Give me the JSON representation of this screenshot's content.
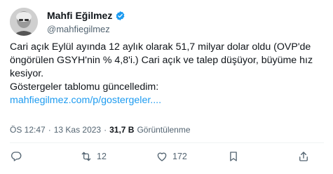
{
  "author": {
    "name": "Mahfi Eğilmez",
    "handle": "@mahfiegilmez",
    "verified": true
  },
  "tweet": {
    "lines": [
      "Cari açık Eylül ayında 12 aylık olarak 51,7 milyar dolar oldu (OVP'de",
      "öngörülen GSYH'nin % 4,8'i.) Cari açık ve talep düşüyor, büyüme hız",
      "kesiyor.",
      "Göstergeler tablomu güncelledim:"
    ],
    "link": "mahfiegilmez.com/p/gostergeler...."
  },
  "meta": {
    "time": "ÖS 12:47",
    "separator": "·",
    "date": "13 Kas 2023",
    "views_count": "31,7 B",
    "views_label": "Görüntülenme"
  },
  "actions": {
    "replies": "",
    "retweets": "12",
    "likes": "172",
    "bookmarks": "",
    "share": ""
  },
  "colors": {
    "accent": "#1d9bf0",
    "text": "#0f1419",
    "secondary": "#536471"
  }
}
